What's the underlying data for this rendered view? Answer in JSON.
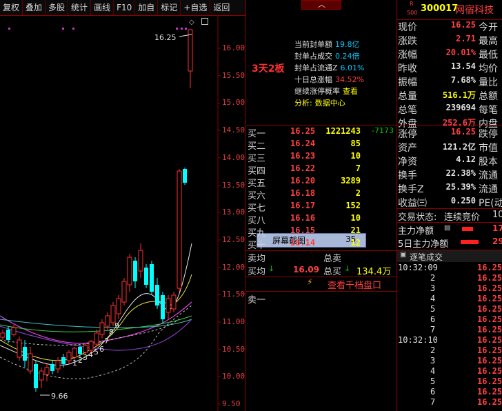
{
  "toolbar": {
    "buttons": [
      "复权",
      "叠加",
      "多股",
      "统计",
      "画线",
      "F10",
      "加自",
      "标记",
      "+自选",
      "返回"
    ]
  },
  "chart": {
    "price_levels": [
      "16.00",
      "15.50",
      "15.00",
      "14.50",
      "14.00",
      "13.50",
      "13.00",
      "12.50",
      "12.00",
      "11.50",
      "11.00",
      "10.50",
      "10.00",
      "9.50"
    ],
    "high_label": "16.25",
    "low_label": "9.66",
    "count_labels": [
      "1",
      "2",
      "3",
      "4",
      "5",
      "6",
      "7",
      "8",
      "9"
    ]
  },
  "popup": {
    "label": "屏幕截图",
    "value": "35"
  },
  "seal_info": {
    "tag": "3天2板",
    "lines": [
      {
        "label": "当前封单额",
        "value": "19.8亿"
      },
      {
        "label": "封单占成交",
        "value": "0.24倍"
      },
      {
        "label": "封单占流通Z",
        "value": "6.01%"
      },
      {
        "label": "十日总涨幅",
        "value": "34.52%"
      },
      {
        "label": "继续涨停概率",
        "value": "查看"
      },
      {
        "label": "分析:",
        "value": "数据中心"
      }
    ]
  },
  "order_book": {
    "bids": [
      {
        "label": "买一",
        "price": "16.25",
        "volume": "1221243",
        "change": "-7173"
      },
      {
        "label": "买二",
        "price": "16.24",
        "volume": "85",
        "change": ""
      },
      {
        "label": "买三",
        "price": "16.23",
        "volume": "10",
        "change": ""
      },
      {
        "label": "买四",
        "price": "16.22",
        "volume": "7",
        "change": ""
      },
      {
        "label": "买五",
        "price": "16.20",
        "volume": "3289",
        "change": ""
      },
      {
        "label": "买六",
        "price": "16.18",
        "volume": "2",
        "change": ""
      },
      {
        "label": "买七",
        "price": "16.17",
        "volume": "152",
        "change": ""
      },
      {
        "label": "买八",
        "price": "16.16",
        "volume": "10",
        "change": ""
      },
      {
        "label": "买九",
        "price": "16.15",
        "volume": "21",
        "change": ""
      },
      {
        "label": "买十",
        "price": "16.14",
        "volume": "12",
        "change": ""
      }
    ],
    "sell_avg_label": "卖均",
    "buy_avg_label": "买均",
    "buy_avg_value": "16.09",
    "total_sell_label": "总卖",
    "total_buy_label": "总买",
    "total_buy_value": "134.4万",
    "view_thousand": "查看千档盘口",
    "ask1_label": "卖一"
  },
  "stock": {
    "code": "300017",
    "name": "网宿科技",
    "badge_top": "R",
    "badge_bottom": "500"
  },
  "quote": [
    {
      "label": "现价",
      "value": "16.25",
      "color": "#ff4040",
      "right": "今开"
    },
    {
      "label": "涨跌",
      "value": "2.71",
      "color": "#ff4040",
      "right": "最高"
    },
    {
      "label": "涨幅",
      "value": "20.01%",
      "color": "#ff4040",
      "right": "最低"
    },
    {
      "label": "昨收",
      "value": "13.54",
      "color": "#e0e0e0",
      "right": "均价"
    },
    {
      "label": "振幅",
      "value": "7.68%",
      "color": "#e0e0e0",
      "right": "量比"
    },
    {
      "label": "总量",
      "value": "516.1万",
      "color": "#ffff00",
      "right": "总额"
    },
    {
      "label": "总笔",
      "value": "239694",
      "color": "#e0e0e0",
      "right": "每笔"
    },
    {
      "label": "外盘",
      "value": "252.6万",
      "color": "#ff4040",
      "right": "内盘"
    }
  ],
  "quote2": [
    {
      "label": "涨停",
      "value": "16.25",
      "color": "#ff4040",
      "right": "跌停"
    },
    {
      "label": "资产",
      "value": "121.2亿",
      "color": "#e0e0e0",
      "right": "市值"
    },
    {
      "label": "净资",
      "value": "4.12",
      "color": "#e0e0e0",
      "right": "股本"
    },
    {
      "label": "换手",
      "value": "22.38%",
      "color": "#e0e0e0",
      "right": "流通"
    },
    {
      "label": "换手Z",
      "value": "25.39%",
      "color": "#e0e0e0",
      "right": "流通"
    },
    {
      "label": "收益㈢",
      "value": "0.250",
      "color": "#e0e0e0",
      "right": "PE(动"
    }
  ],
  "trade_status": {
    "label": "交易状态:",
    "value": "连续竞价",
    "extra": "10"
  },
  "fund_flow": [
    {
      "label": "主力净额",
      "value": "17"
    },
    {
      "label": "5日主力净额",
      "value": "29"
    }
  ],
  "ticks_header": "逐笔成交",
  "ticks": [
    {
      "time": "10:32:09",
      "idx": "",
      "price": "16.25"
    },
    {
      "time": "",
      "idx": "2",
      "price": "16.25"
    },
    {
      "time": "",
      "idx": "3",
      "price": "16.25"
    },
    {
      "time": "",
      "idx": "4",
      "price": "16.25"
    },
    {
      "time": "",
      "idx": "5",
      "price": "16.25"
    },
    {
      "time": "",
      "idx": "6",
      "price": "16.25"
    },
    {
      "time": "",
      "idx": "7",
      "price": "16.25"
    },
    {
      "time": "10:32:10",
      "idx": "",
      "price": "16.25"
    },
    {
      "time": "",
      "idx": "2",
      "price": "16.25"
    },
    {
      "time": "",
      "idx": "3",
      "price": "16.25"
    },
    {
      "time": "",
      "idx": "4",
      "price": "16.25"
    },
    {
      "time": "",
      "idx": "5",
      "price": "16.25"
    },
    {
      "time": "",
      "idx": "6",
      "price": "16.25"
    },
    {
      "time": "",
      "idx": "7",
      "price": "16.25"
    }
  ],
  "colors": {
    "up": "#ff3030",
    "down": "#00ffff",
    "grid": "#8b0000",
    "bg": "#000000"
  }
}
